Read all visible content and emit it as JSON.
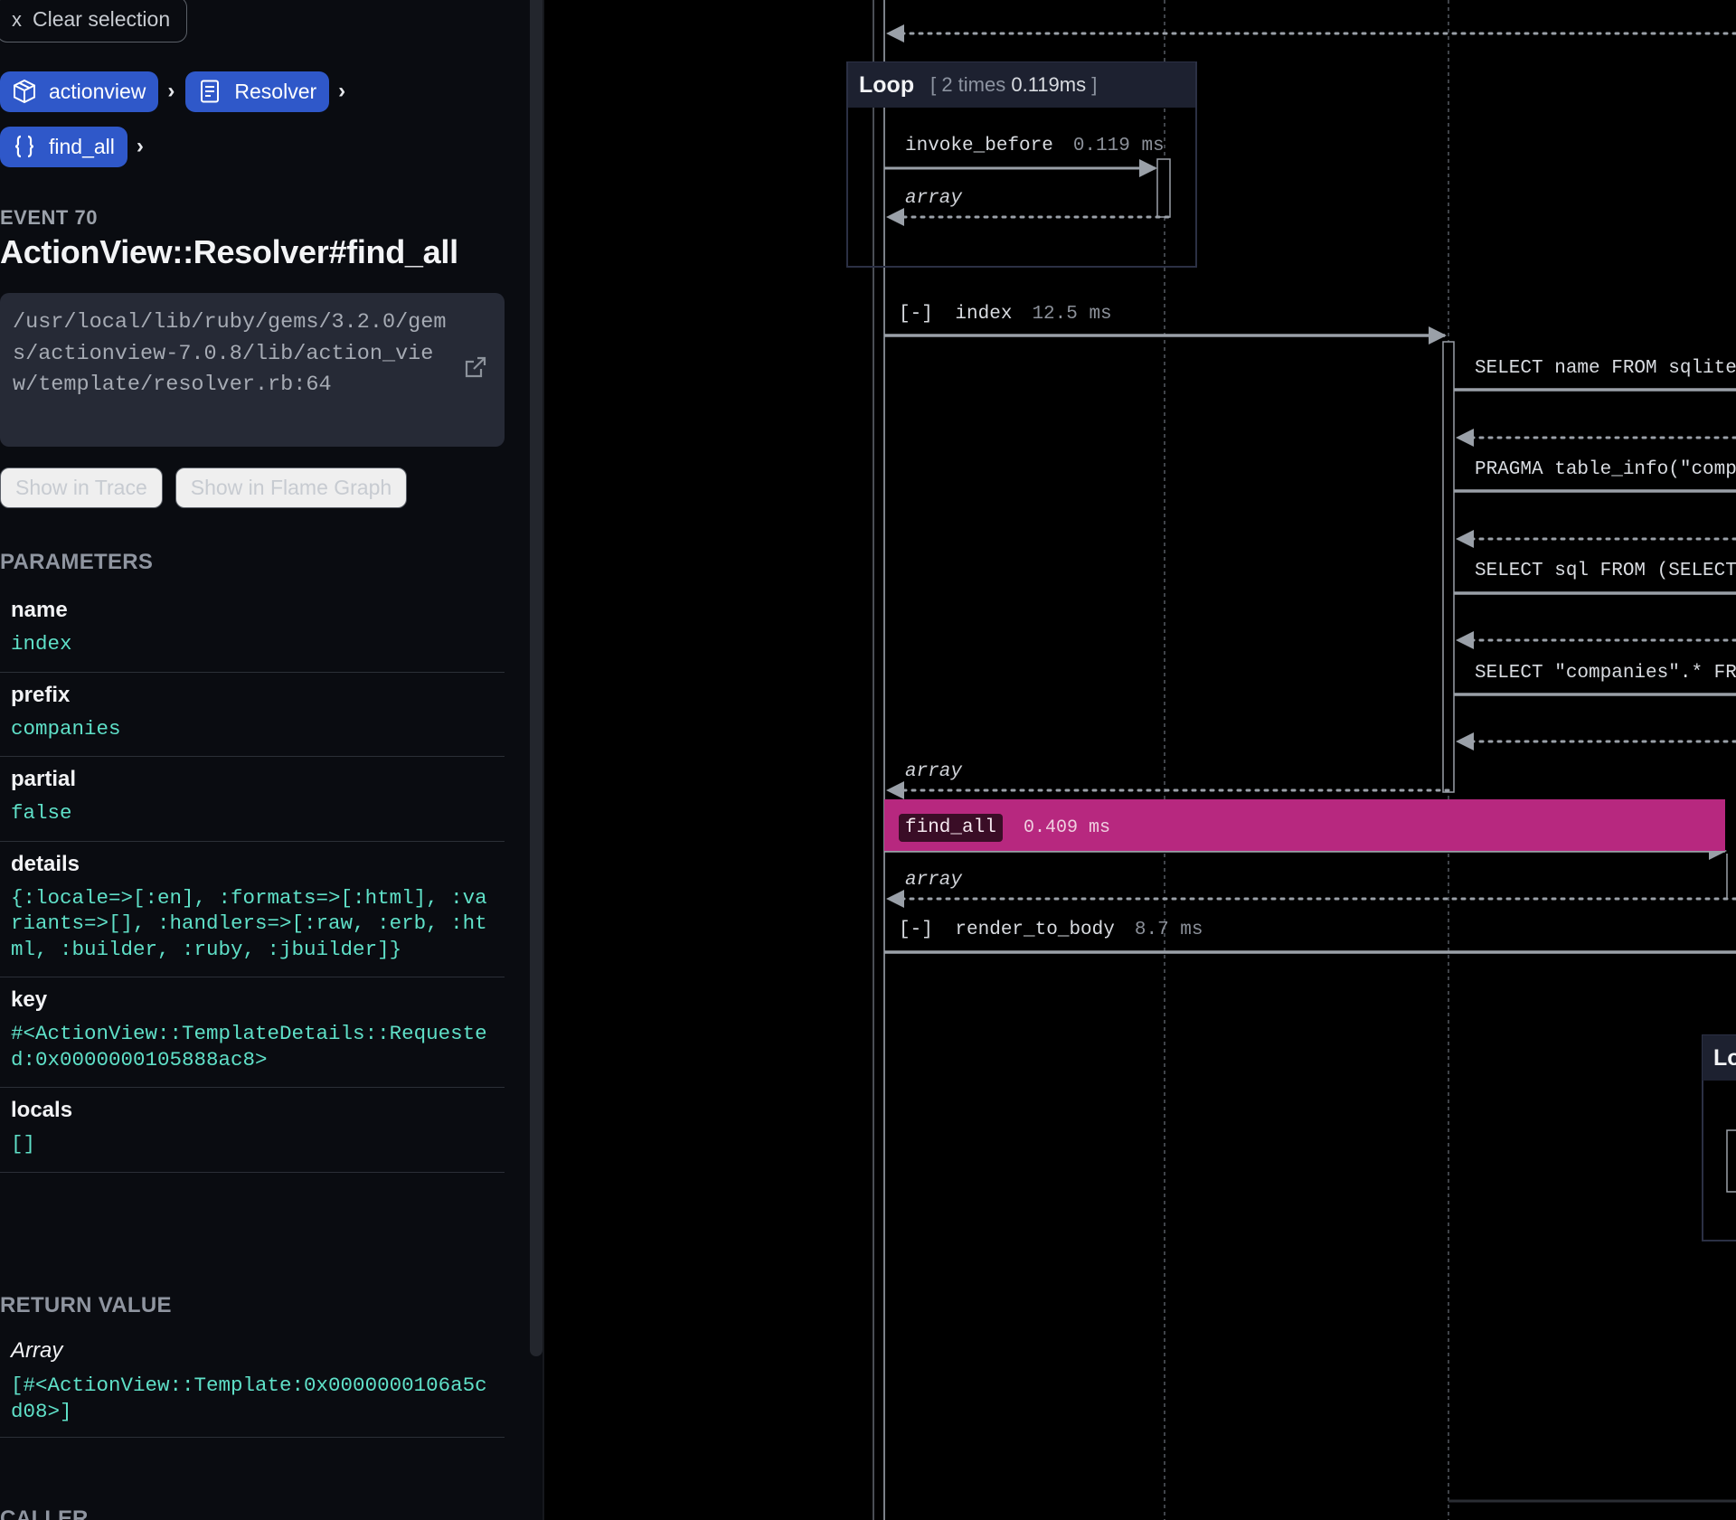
{
  "clear_selection": {
    "icon": "x",
    "label": "Clear selection"
  },
  "breadcrumbs": [
    {
      "label": "actionview",
      "icon": "package-icon"
    },
    {
      "label": "Resolver",
      "icon": "document-icon"
    },
    {
      "label": "find_all",
      "icon": "braces-icon"
    }
  ],
  "breadcrumb_separator": "›",
  "event": {
    "label": "EVENT 70",
    "title": "ActionView::Resolver#find_all",
    "path": "/usr/local/lib/ruby/gems/3.2.0/gems/actionview-7.0.8/lib/action_view/template/resolver.rb:64"
  },
  "actions": {
    "show_in_trace": "Show in Trace",
    "show_in_flame_graph": "Show in Flame Graph"
  },
  "parameters": {
    "title": "PARAMETERS",
    "items": [
      {
        "name": "name",
        "value": "index"
      },
      {
        "name": "prefix",
        "value": "companies"
      },
      {
        "name": "partial",
        "value": "false"
      },
      {
        "name": "details",
        "value": "{:locale=>[:en], :formats=>[:html], :variants=>[], :handlers=>[:raw, :erb, :html, :builder, :ruby, :jbuilder]}"
      },
      {
        "name": "key",
        "value": "#<ActionView::TemplateDetails::Requested:0x0000000105888ac8>"
      },
      {
        "name": "locals",
        "value": "[]"
      }
    ]
  },
  "return_value": {
    "title": "RETURN VALUE",
    "type": "Array",
    "value": "[#<ActionView::Template:0x0000000106a5cd08>]"
  },
  "caller_title": "CALLER",
  "diagram": {
    "loop": {
      "title": "Loop",
      "info_prefix": "[ 2 times",
      "info_time": "0.119ms",
      "info_suffix": "]"
    },
    "invoke_before": {
      "label": "invoke_before",
      "duration": "0.119 ms"
    },
    "return_array": "array",
    "index": {
      "toggle": "[-]",
      "label": "index",
      "duration": "12.5 ms"
    },
    "queries": [
      "SELECT name FROM sqlite",
      "PRAGMA table_info(\"comp",
      "SELECT sql FROM (SELECT",
      "SELECT \"companies\".* FR"
    ],
    "find_all": {
      "label": "find_all",
      "duration": "0.409 ms",
      "highlight_color": "#b7287f"
    },
    "render_to_body": {
      "toggle": "[-]",
      "label": "render_to_body",
      "duration": "8.7 ms"
    },
    "loop2_title": "Lo"
  },
  "colors": {
    "accent": "#2f58c9",
    "value_text": "#5fe0c8",
    "panel": "#0a0c11",
    "highlight": "#b7287f"
  }
}
